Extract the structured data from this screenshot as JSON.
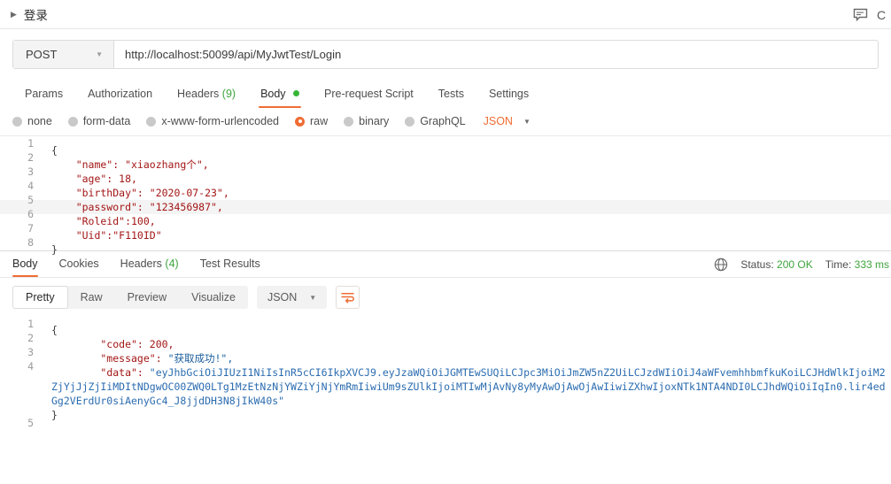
{
  "window": {
    "tab_title": "登录",
    "caret_icon": "triangle-right-icon",
    "comment_icon": "comment-icon",
    "clipped_text": "C"
  },
  "request": {
    "method": "POST",
    "method_caret": "chevron-down-icon",
    "url": "http://localhost:50099/api/MyJwtTest/Login",
    "tabs": [
      {
        "label": "Params",
        "count": "",
        "active": false,
        "dot": false
      },
      {
        "label": "Authorization",
        "count": "",
        "active": false,
        "dot": false
      },
      {
        "label": "Headers",
        "count": "(9)",
        "active": false,
        "dot": false
      },
      {
        "label": "Body",
        "count": "",
        "active": true,
        "dot": true
      },
      {
        "label": "Pre-request Script",
        "count": "",
        "active": false,
        "dot": false
      },
      {
        "label": "Tests",
        "count": "",
        "active": false,
        "dot": false
      },
      {
        "label": "Settings",
        "count": "",
        "active": false,
        "dot": false
      }
    ],
    "body_types": [
      {
        "label": "none",
        "selected": false
      },
      {
        "label": "form-data",
        "selected": false
      },
      {
        "label": "x-www-form-urlencoded",
        "selected": false
      },
      {
        "label": "raw",
        "selected": true
      },
      {
        "label": "binary",
        "selected": false
      },
      {
        "label": "GraphQL",
        "selected": false
      }
    ],
    "format_label": "JSON",
    "format_caret": "chevron-down-icon",
    "body_lines": [
      {
        "num": "1",
        "text": "{",
        "highlight": false
      },
      {
        "num": "2",
        "text": "    \"name\": \"xiaozhang个\",",
        "highlight": false
      },
      {
        "num": "3",
        "text": "    \"age\": 18,",
        "highlight": false
      },
      {
        "num": "4",
        "text": "    \"birthDay\": \"2020-07-23\",",
        "highlight": false
      },
      {
        "num": "5",
        "text": "    \"password\": \"123456987\",",
        "highlight": true
      },
      {
        "num": "6",
        "text": "    \"Roleid\":100,",
        "highlight": false
      },
      {
        "num": "7",
        "text": "    \"Uid\":\"F110ID\"",
        "highlight": false
      },
      {
        "num": "8",
        "text": "}",
        "highlight": false
      }
    ]
  },
  "response": {
    "tabs": [
      {
        "label": "Body",
        "count": "",
        "active": true
      },
      {
        "label": "Cookies",
        "count": "",
        "active": false
      },
      {
        "label": "Headers",
        "count": "(4)",
        "active": false
      },
      {
        "label": "Test Results",
        "count": "",
        "active": false
      }
    ],
    "globe_icon": "globe-icon",
    "status_label": "Status:",
    "status_value": "200 OK",
    "time_label": "Time:",
    "time_value": "333 ms",
    "view_modes": [
      {
        "label": "Pretty",
        "active": true
      },
      {
        "label": "Raw",
        "active": false
      },
      {
        "label": "Preview",
        "active": false
      },
      {
        "label": "Visualize",
        "active": false
      }
    ],
    "format_label": "JSON",
    "format_caret": "chevron-down-icon",
    "wrap_icon": "word-wrap-icon",
    "line1_num": "1",
    "line1_text": "{",
    "line2_num": "2",
    "line2_text": "        \"code\": 200,",
    "line3_num": "3",
    "line3_key": "        \"message\": ",
    "line3_value": "\"获取成功!\",",
    "line4_num": "4",
    "line4_key": "        \"data\": ",
    "line4_token": "\"eyJhbGciOiJIUzI1NiIsInR5cCI6IkpXVCJ9.eyJzaWQiOiJGMTEwSUQiLCJpc3MiOiJmZW5nZ2UiLCJzdWIiOiJ4aWFvemhhbmfkuKoiLCJHdWlkIjoiM2ZjYjJjZjIiMDItNDgwOC00ZWQ0LTg1MzEtNzNjYWZiYjNjYmRmIiwiUm9sZUlkIjoiMTIwMjAvNy8yMyAwOjAwOjAwIiwiZXhwIjoxNTk1NTA4NDI0LCJhdWQiOiIqIn0.lir4edGg2VErdUr0siAenyGc4_J8jjdDH3N8jIkW40s\"",
    "line5_num": "5",
    "line5_text": "}"
  }
}
